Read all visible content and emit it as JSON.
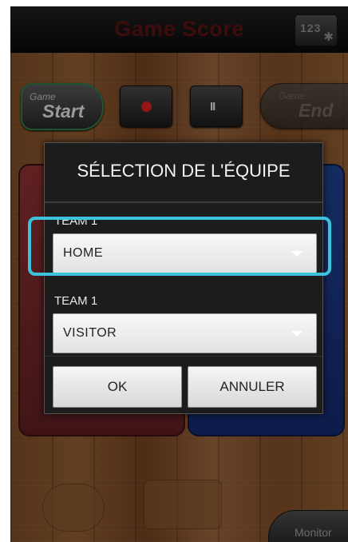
{
  "header": {
    "title": "Game Score",
    "settings_digits": "123"
  },
  "controls": {
    "game_start_small": "Game",
    "game_start_big": "Start",
    "game_end_small": "Game",
    "game_end_big": "End",
    "pause_glyph": "II"
  },
  "footer": {
    "monitor_label": "Monitor"
  },
  "dialog": {
    "title": "SÉLECTION DE L'ÉQUIPE",
    "field1_label": "TEAM 1",
    "field1_value": "HOME",
    "field2_label": "TEAM 1",
    "field2_value": "VISITOR",
    "ok_label": "OK",
    "cancel_label": "ANNULER"
  },
  "colors": {
    "highlight": "#3cc2da",
    "title_text": "#5a1310",
    "team_home": "#8a3030",
    "team_visitor": "#1f3f8a",
    "game_start_border": "#2a7a48",
    "record_dot": "#d62020"
  },
  "icons": {
    "settings": "gear-icon",
    "record": "record-icon",
    "pause": "pause-icon",
    "dropdown": "chevron-down-icon"
  }
}
